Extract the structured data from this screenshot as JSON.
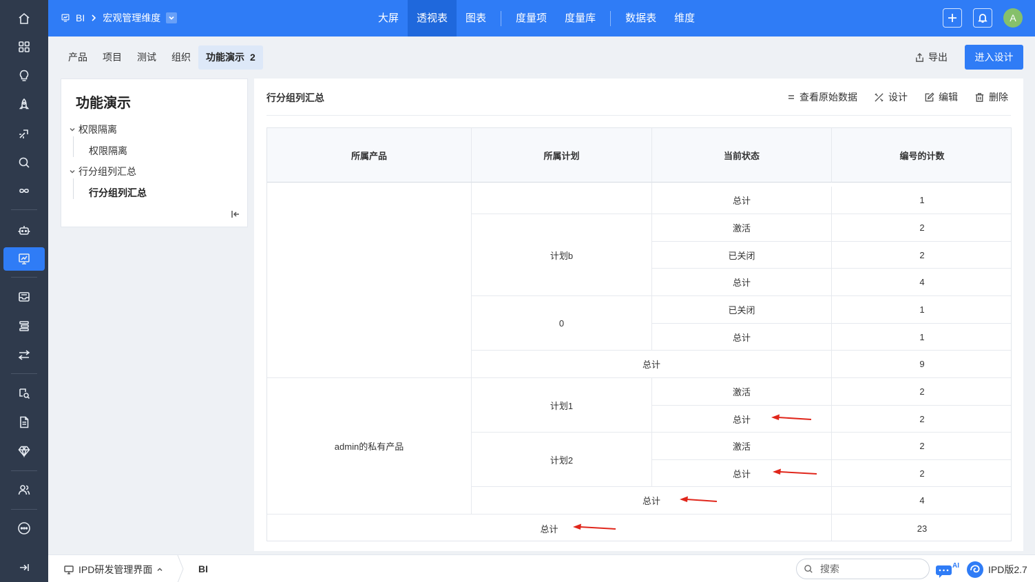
{
  "rail": {
    "items": [
      "home-icon",
      "apps-grid-icon",
      "lightbulb-icon",
      "rocket-icon",
      "launch-icon",
      "search-icon",
      "infinity-icon",
      "robot-icon",
      "bi-chart-icon",
      "mailbox-icon",
      "layers-icon",
      "swap-icon",
      "inspect-icon",
      "document-icon",
      "diamond-icon",
      "team-icon",
      "more-icon",
      "expand-icon"
    ],
    "active": "bi-chart-icon"
  },
  "header": {
    "breadcrumb_root": "BI",
    "breadcrumb_current": "宏观管理维度",
    "nav": [
      "大屏",
      "透视表",
      "图表",
      "度量项",
      "度量库",
      "数据表",
      "维度"
    ],
    "active_nav": "透视表",
    "avatar_letter": "A",
    "accent": "#2f7cf6"
  },
  "tabs": {
    "items": [
      "产品",
      "项目",
      "测试",
      "组织",
      "功能演示"
    ],
    "active_badge": "2",
    "export_label": "导出",
    "design_label": "进入设计"
  },
  "tree": {
    "title": "功能演示",
    "groups": [
      {
        "label": "权限隔离",
        "child": "权限隔离"
      },
      {
        "label": "行分组列汇总",
        "child": "行分组列汇总"
      }
    ]
  },
  "panel": {
    "title": "行分组列汇总",
    "actions": {
      "view_raw": "查看原始数据",
      "design": "设计",
      "edit": "编辑",
      "delete": "删除"
    }
  },
  "table": {
    "headers": [
      "所属产品",
      "所属计划",
      "当前状态",
      "编号的计数"
    ],
    "product_a": "",
    "product_b": "admin的私有产品",
    "rows": {
      "r1": {
        "plan": "",
        "status": "总计",
        "count": "1"
      },
      "r2": {
        "plan": "计划b",
        "status": "激活",
        "count": "2"
      },
      "r3": {
        "status": "已关闭",
        "count": "2"
      },
      "r4": {
        "status": "总计",
        "count": "4"
      },
      "r5": {
        "plan": "0",
        "status": "已关闭",
        "count": "1"
      },
      "r6": {
        "status": "总计",
        "count": "1"
      },
      "r7": {
        "label": "总计",
        "count": "9"
      },
      "r8": {
        "plan": "计划1",
        "status": "激活",
        "count": "2"
      },
      "r9": {
        "status": "总计",
        "count": "2"
      },
      "r10": {
        "plan": "计划2",
        "status": "激活",
        "count": "2"
      },
      "r11": {
        "status": "总计",
        "count": "2"
      },
      "r12": {
        "label": "总计",
        "count": "4"
      },
      "grand": {
        "label": "总计",
        "count": "23"
      }
    }
  },
  "bottom": {
    "app": "IPD研发管理界面",
    "current": "BI",
    "search_placeholder": "搜索",
    "ai_badge": "AI",
    "version": "IPD版2.7"
  }
}
